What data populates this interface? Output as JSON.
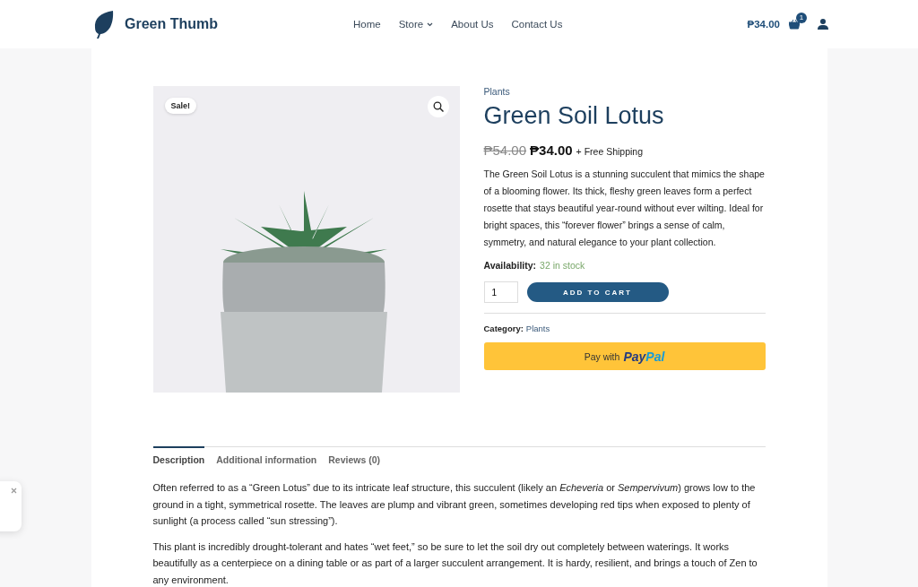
{
  "header": {
    "brand": "Green Thumb",
    "nav": [
      {
        "label": "Home",
        "has_dropdown": false
      },
      {
        "label": "Store",
        "has_dropdown": true
      },
      {
        "label": "About Us",
        "has_dropdown": false
      },
      {
        "label": "Contact Us",
        "has_dropdown": false
      }
    ],
    "cart_total": "₱34.00",
    "cart_count": "1"
  },
  "product": {
    "badge": "Sale!",
    "category_link": "Plants",
    "title": "Green Soil Lotus",
    "old_price": "₱54.00",
    "price": "₱34.00",
    "shipping": "+ Free Shipping",
    "summary": "The Green Soil Lotus is a stunning succulent that mimics the shape of a blooming flower. Its thick, fleshy green leaves form a perfect rosette that stays beautiful year-round without ever wilting. Ideal for bright spaces, this “forever flower” brings a sense of calm, symmetry, and natural elegance to your plant collection.",
    "availability_label": "Availability:",
    "availability": "32 in stock",
    "quantity": "1",
    "add_to_cart": "ADD TO CART",
    "category_label": "Category:",
    "category": "Plants",
    "paypal_prefix": "Pay with",
    "paypal_logo": [
      "Pay",
      "Pal"
    ]
  },
  "tabs": [
    {
      "label": "Description",
      "selected": true
    },
    {
      "label": "Additional information",
      "selected": false
    },
    {
      "label": "Reviews (0)",
      "selected": false
    }
  ],
  "description": [
    "Often referred to as a “Green Lotus” due to its intricate leaf structure, this succulent (likely an *Echeveria* or *Sempervivum*) grows low to the ground in a tight, symmetrical rosette. The leaves are plump and vibrant green, sometimes developing red tips when exposed to plenty of sunlight (a process called “sun stressing”).",
    "This plant is incredibly drought-tolerant and hates “wet feet,” so be sure to let the soil dry out completely between waterings. It works beautifully as a centerpiece on a dining table or as part of a larger succulent arrangement. It is hardy, resilient, and brings a touch of Zen to any environment."
  ]
}
